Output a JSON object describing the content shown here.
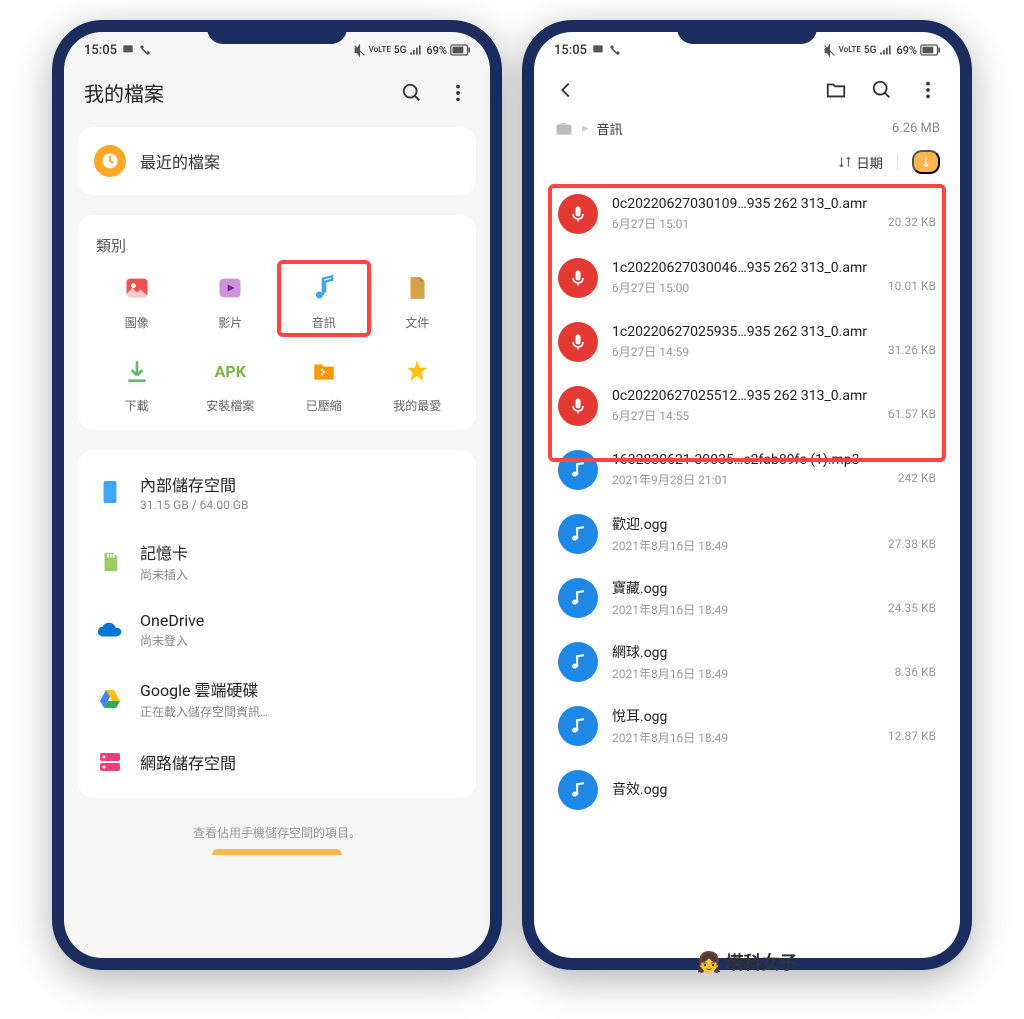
{
  "status": {
    "time": "15:05",
    "battery": "69%",
    "network": "5G",
    "lte": "LTE1"
  },
  "phone1": {
    "header": {
      "title": "我的檔案"
    },
    "recent": {
      "label": "最近的檔案"
    },
    "categories": {
      "title": "類別",
      "items": [
        {
          "label": "圖像",
          "icon": "image",
          "color": "#ef5350"
        },
        {
          "label": "影片",
          "icon": "video",
          "color": "#ab47bc"
        },
        {
          "label": "音訊",
          "icon": "audio",
          "color": "#42a5f5",
          "highlighted": true
        },
        {
          "label": "文件",
          "icon": "document",
          "color": "#d4a147"
        },
        {
          "label": "下載",
          "icon": "download",
          "color": "#66bb6a"
        },
        {
          "label": "安裝檔案",
          "icon": "apk",
          "color": "#7cb342"
        },
        {
          "label": "已壓縮",
          "icon": "zip",
          "color": "#ff9800"
        },
        {
          "label": "我的最愛",
          "icon": "star",
          "color": "#ffc107"
        }
      ]
    },
    "storage": [
      {
        "name": "內部儲存空間",
        "sub": "31.15 GB / 64.00 GB",
        "icon": "internal",
        "color": "#42a5f5"
      },
      {
        "name": "記憶卡",
        "sub": "尚未插入",
        "icon": "sdcard",
        "color": "#9ccc65"
      },
      {
        "name": "OneDrive",
        "sub": "尚未登入",
        "icon": "onedrive",
        "color": "#0078d4"
      },
      {
        "name": "Google 雲端硬碟",
        "sub": "正在載入儲存空間資訊…",
        "icon": "gdrive",
        "color": "#4285f4"
      },
      {
        "name": "網路儲存空間",
        "sub": "",
        "icon": "network",
        "color": "#ec407a"
      }
    ],
    "footer": "查看佔用手機儲存空間的項目。"
  },
  "phone2": {
    "breadcrumb": {
      "current": "音訊",
      "size": "6.26 MB"
    },
    "sort": {
      "label": "日期"
    },
    "files": [
      {
        "name": "0c20220627030109…935 262 313_0.amr",
        "date": "6月27日 15:01",
        "size": "20.32 KB",
        "type": "voice"
      },
      {
        "name": "1c20220627030046…935 262 313_0.amr",
        "date": "6月27日 15:00",
        "size": "10.01 KB",
        "type": "voice"
      },
      {
        "name": "1c20220627025935…935 262 313_0.amr",
        "date": "6月27日 14:59",
        "size": "31.26 KB",
        "type": "voice"
      },
      {
        "name": "0c20220627025512…935 262 313_0.amr",
        "date": "6月27日 14:55",
        "size": "61.57 KB",
        "type": "voice"
      },
      {
        "name": "1632830621-39035…e2fab89fe (1).mp3",
        "date": "2021年9月28日 21:01",
        "size": "242 KB",
        "type": "audio"
      },
      {
        "name": "歡迎.ogg",
        "date": "2021年8月16日 18:49",
        "size": "27.38 KB",
        "type": "audio"
      },
      {
        "name": "寶藏.ogg",
        "date": "2021年8月16日 18:49",
        "size": "24.35 KB",
        "type": "audio"
      },
      {
        "name": "網球.ogg",
        "date": "2021年8月16日 18:49",
        "size": "8.36 KB",
        "type": "audio"
      },
      {
        "name": "悅耳.ogg",
        "date": "2021年8月16日 18:49",
        "size": "12.87 KB",
        "type": "audio"
      },
      {
        "name": "音效.ogg",
        "date": "",
        "size": "",
        "type": "audio"
      }
    ]
  },
  "watermark": "塔科女子"
}
